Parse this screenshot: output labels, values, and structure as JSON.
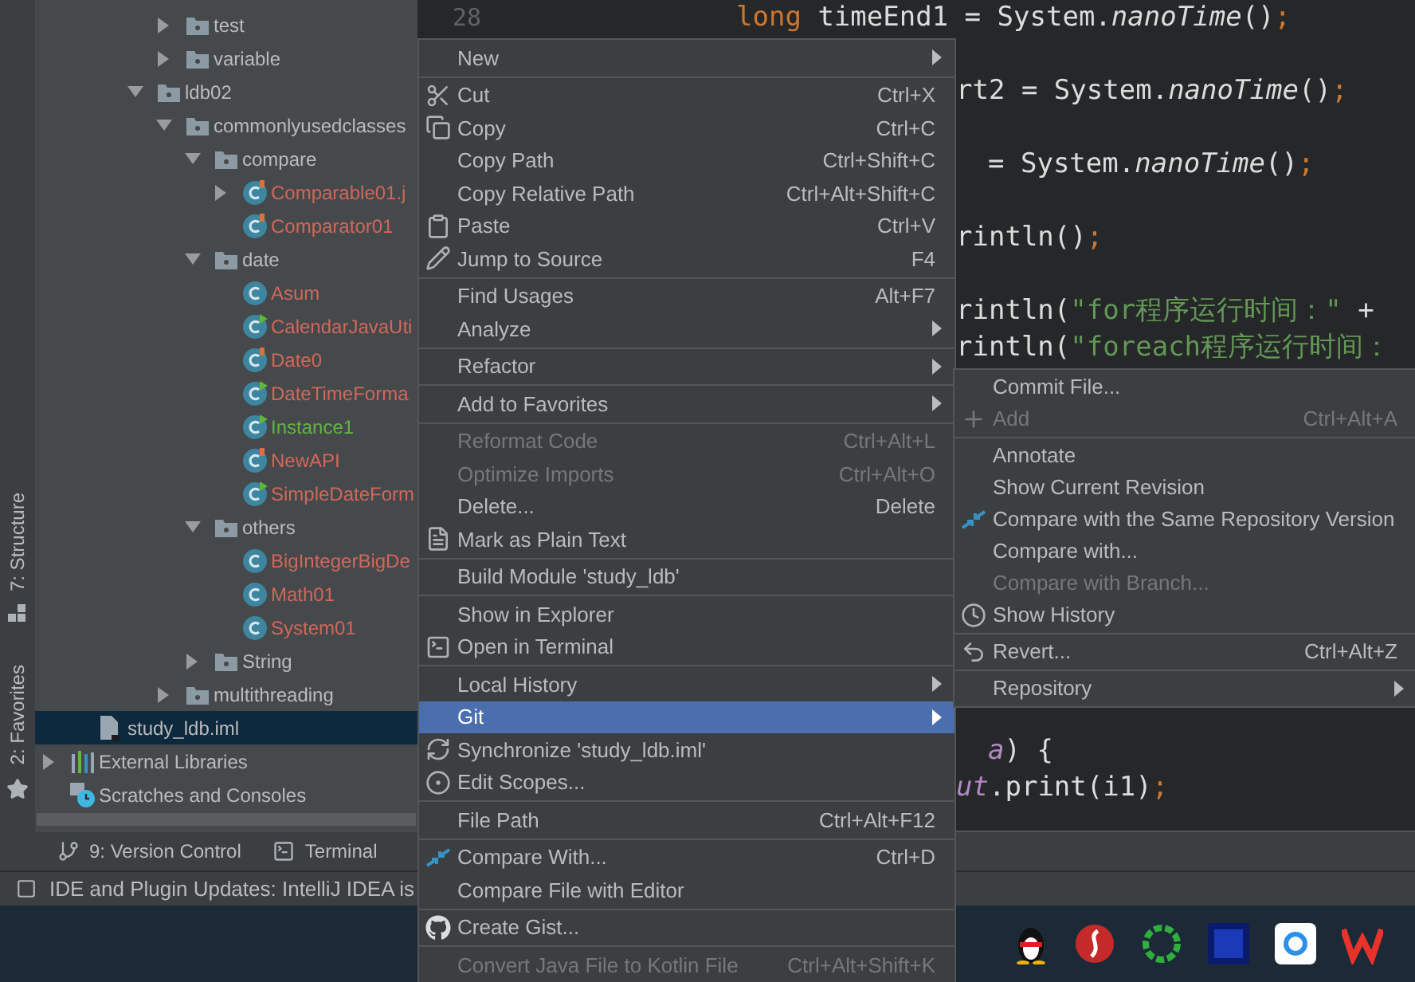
{
  "side_tabs": [
    {
      "label": "7: Structure",
      "kind": "structure"
    },
    {
      "label": "2: Favorites",
      "kind": "favorites"
    }
  ],
  "project_tree": {
    "items": [
      {
        "label": "test",
        "kind": "folder",
        "expanded": false,
        "selected": false
      },
      {
        "label": "variable",
        "kind": "folder",
        "expanded": false,
        "selected": false
      },
      {
        "label": "ldb02",
        "kind": "folder",
        "expanded": true,
        "selected": false,
        "children": [
          {
            "label": "commonlyusedclasses",
            "kind": "folder",
            "expanded": true,
            "selected": false,
            "children": [
              {
                "label": "compare",
                "kind": "folder",
                "expanded": true,
                "selected": false,
                "children": [
                  {
                    "label": "Comparable01.j",
                    "kind": "flagged-class",
                    "color": "#d1675a",
                    "expanded": false,
                    "selected": false
                  },
                  {
                    "label": "Comparator01",
                    "kind": "flagged-class",
                    "color": "#d1675a",
                    "selected": false
                  }
                ]
              },
              {
                "label": "date",
                "kind": "folder",
                "expanded": true,
                "selected": false,
                "children": [
                  {
                    "label": "Asum",
                    "kind": "class",
                    "color": "#d1675a",
                    "selected": false
                  },
                  {
                    "label": "CalendarJavaUti",
                    "kind": "runnable-class",
                    "color": "#d1675a",
                    "selected": false
                  },
                  {
                    "label": "Date0",
                    "kind": "flagged-class",
                    "color": "#d1675a",
                    "selected": false
                  },
                  {
                    "label": "DateTimeForma",
                    "kind": "runnable-class",
                    "color": "#d1675a",
                    "selected": false
                  },
                  {
                    "label": "Instance1",
                    "kind": "runnable-class",
                    "color": "#62b543",
                    "selected": false
                  },
                  {
                    "label": "NewAPI",
                    "kind": "flagged-class",
                    "color": "#d1675a",
                    "selected": false
                  },
                  {
                    "label": "SimpleDateForm",
                    "kind": "runnable-class",
                    "color": "#d1675a",
                    "selected": false
                  }
                ]
              },
              {
                "label": "others",
                "kind": "folder",
                "expanded": true,
                "selected": false,
                "children": [
                  {
                    "label": "BigIntegerBigDe",
                    "kind": "class",
                    "color": "#d1675a",
                    "selected": false
                  },
                  {
                    "label": "Math01",
                    "kind": "class",
                    "color": "#d1675a",
                    "selected": false
                  },
                  {
                    "label": "System01",
                    "kind": "class",
                    "color": "#d1675a",
                    "selected": false
                  }
                ]
              },
              {
                "label": "String",
                "kind": "folder",
                "expanded": false,
                "selected": false
              }
            ]
          },
          {
            "label": "multithreading",
            "kind": "folder",
            "expanded": false,
            "selected": false
          }
        ]
      },
      {
        "label": "study_ldb.iml",
        "kind": "module-file",
        "selected": true
      },
      {
        "label": "External Libraries",
        "kind": "library",
        "expanded": false,
        "selected": false
      },
      {
        "label": "Scratches and Consoles",
        "kind": "scratches",
        "selected": false
      }
    ]
  },
  "editor": {
    "line_number": "28",
    "lines": [
      {
        "segments": [
          {
            "text": "long",
            "kind": "keyword"
          },
          {
            "text": " timeEnd1 = System.",
            "kind": "plain"
          },
          {
            "text": "nanoTime",
            "kind": "method"
          },
          {
            "text": "()",
            "kind": "plain"
          },
          {
            "text": ";",
            "kind": "punct"
          }
        ]
      },
      {
        "segments": [
          {
            "text": "rt2 = System.",
            "kind": "plain"
          },
          {
            "text": "nanoTime",
            "kind": "method"
          },
          {
            "text": "()",
            "kind": "plain"
          },
          {
            "text": ";",
            "kind": "punct"
          }
        ]
      },
      {
        "segments": [
          {
            "text": "= System.",
            "kind": "plain"
          },
          {
            "text": "nanoTime",
            "kind": "method"
          },
          {
            "text": "()",
            "kind": "plain"
          },
          {
            "text": ";",
            "kind": "punct"
          }
        ]
      },
      {
        "segments": [
          {
            "text": "rintln()",
            "kind": "plain"
          },
          {
            "text": ";",
            "kind": "punct"
          }
        ]
      },
      {
        "segments": [
          {
            "text": "rintln(",
            "kind": "plain"
          },
          {
            "text": "\"for程序运行时间：\"",
            "kind": "string"
          },
          {
            "text": " +",
            "kind": "plain"
          }
        ]
      },
      {
        "segments": [
          {
            "text": "rintln(",
            "kind": "plain"
          },
          {
            "text": "\"foreach程序运行时间：",
            "kind": "string"
          }
        ]
      },
      {
        "segments": [
          {
            "text": "a",
            "kind": "param"
          },
          {
            "text": ") {",
            "kind": "plain"
          }
        ]
      },
      {
        "segments": [
          {
            "text": "ut",
            "kind": "param"
          },
          {
            "text": ".print(i1)",
            "kind": "plain"
          },
          {
            "text": ";",
            "kind": "punct"
          }
        ]
      }
    ]
  },
  "context_menu": {
    "groups": [
      [
        {
          "label": "New",
          "submenu": true,
          "disabled": false,
          "selected": false
        }
      ],
      [
        {
          "label": "Cut",
          "shortcut": "Ctrl+X",
          "kind": "scissors",
          "disabled": false,
          "selected": false
        },
        {
          "label": "Copy",
          "shortcut": "Ctrl+C",
          "kind": "copy",
          "disabled": false,
          "selected": false
        },
        {
          "label": "Copy Path",
          "shortcut": "Ctrl+Shift+C",
          "disabled": false,
          "selected": false
        },
        {
          "label": "Copy Relative Path",
          "shortcut": "Ctrl+Alt+Shift+C",
          "disabled": false,
          "selected": false
        },
        {
          "label": "Paste",
          "shortcut": "Ctrl+V",
          "kind": "clipboard",
          "disabled": false,
          "selected": false
        },
        {
          "label": "Jump to Source",
          "shortcut": "F4",
          "kind": "pencil",
          "disabled": false,
          "selected": false
        }
      ],
      [
        {
          "label": "Find Usages",
          "shortcut": "Alt+F7",
          "disabled": false,
          "selected": false
        },
        {
          "label": "Analyze",
          "submenu": true,
          "disabled": false,
          "selected": false
        }
      ],
      [
        {
          "label": "Refactor",
          "submenu": true,
          "disabled": false,
          "selected": false
        }
      ],
      [
        {
          "label": "Add to Favorites",
          "submenu": true,
          "disabled": false,
          "selected": false
        }
      ],
      [
        {
          "label": "Reformat Code",
          "shortcut": "Ctrl+Alt+L",
          "disabled": true,
          "selected": false
        },
        {
          "label": "Optimize Imports",
          "shortcut": "Ctrl+Alt+O",
          "disabled": true,
          "selected": false
        },
        {
          "label": "Delete...",
          "shortcut": "Delete",
          "disabled": false,
          "selected": false
        },
        {
          "label": "Mark as Plain Text",
          "kind": "textfile",
          "disabled": false,
          "selected": false
        }
      ],
      [
        {
          "label": "Build Module 'study_ldb'",
          "disabled": false,
          "selected": false
        }
      ],
      [
        {
          "label": "Show in Explorer",
          "disabled": false,
          "selected": false
        },
        {
          "label": "Open in Terminal",
          "kind": "terminal",
          "disabled": false,
          "selected": false
        }
      ],
      [
        {
          "label": "Local History",
          "submenu": true,
          "disabled": false,
          "selected": false
        },
        {
          "label": "Git",
          "submenu": true,
          "disabled": false,
          "selected": true
        },
        {
          "label": "Synchronize 'study_ldb.iml'",
          "kind": "sync",
          "disabled": false,
          "selected": false
        },
        {
          "label": "Edit Scopes...",
          "kind": "radio",
          "disabled": false,
          "selected": false
        }
      ],
      [
        {
          "label": "File Path",
          "shortcut": "Ctrl+Alt+F12",
          "disabled": false,
          "selected": false
        }
      ],
      [
        {
          "label": "Compare With...",
          "shortcut": "Ctrl+D",
          "kind": "compare",
          "disabled": false,
          "selected": false
        },
        {
          "label": "Compare File with Editor",
          "disabled": false,
          "selected": false
        }
      ],
      [
        {
          "label": "Create Gist...",
          "kind": "github",
          "disabled": false,
          "selected": false
        }
      ],
      [
        {
          "label": "Convert Java File to Kotlin File",
          "shortcut": "Ctrl+Alt+Shift+K",
          "disabled": true,
          "selected": false
        }
      ]
    ]
  },
  "git_submenu": {
    "groups": [
      [
        {
          "label": "Commit File...",
          "disabled": false,
          "selected": false
        },
        {
          "label": "Add",
          "shortcut": "Ctrl+Alt+A",
          "kind": "plus",
          "disabled": true,
          "selected": false
        }
      ],
      [
        {
          "label": "Annotate",
          "disabled": false,
          "selected": false
        },
        {
          "label": "Show Current Revision",
          "disabled": false,
          "selected": false
        },
        {
          "label": "Compare with the Same Repository Version",
          "kind": "compare",
          "disabled": false,
          "selected": false
        },
        {
          "label": "Compare with...",
          "disabled": false,
          "selected": false
        },
        {
          "label": "Compare with Branch...",
          "disabled": true,
          "selected": false
        },
        {
          "label": "Show History",
          "kind": "clock",
          "disabled": false,
          "selected": false
        }
      ],
      [
        {
          "label": "Revert...",
          "shortcut": "Ctrl+Alt+Z",
          "kind": "revert",
          "disabled": false,
          "selected": false
        }
      ],
      [
        {
          "label": "Repository",
          "submenu": true,
          "disabled": false,
          "selected": false
        }
      ]
    ]
  },
  "tool_window_bar": [
    {
      "label": "9: Version Control",
      "kind": "vcs"
    },
    {
      "label": "Terminal",
      "kind": "terminal"
    }
  ],
  "status_bar": {
    "message": "IDE and Plugin Updates: IntelliJ IDEA is"
  }
}
